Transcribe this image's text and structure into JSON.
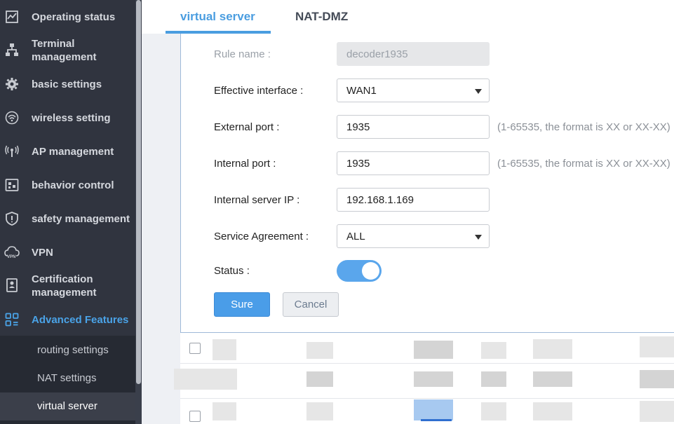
{
  "sidebar": {
    "items": [
      {
        "label": "Operating status",
        "icon": "chart-icon"
      },
      {
        "label": "Terminal\nmanagement",
        "icon": "network-icon"
      },
      {
        "label": "basic settings",
        "icon": "gear-icon"
      },
      {
        "label": "wireless setting",
        "icon": "wifi-icon"
      },
      {
        "label": "AP management",
        "icon": "antenna-icon"
      },
      {
        "label": "behavior control",
        "icon": "behavior-icon"
      },
      {
        "label": "safety management",
        "icon": "shield-icon"
      },
      {
        "label": "VPN",
        "icon": "vpn-cloud-icon"
      },
      {
        "label": "Certification\nmanagement",
        "icon": "certificate-icon"
      },
      {
        "label": "Advanced Features",
        "icon": "grid-icon",
        "active": true
      }
    ],
    "submenu": [
      {
        "label": "routing settings"
      },
      {
        "label": "NAT settings"
      },
      {
        "label": "virtual server",
        "active": true
      }
    ]
  },
  "tabs": [
    {
      "label": "virtual server",
      "active": true
    },
    {
      "label": "NAT-DMZ"
    }
  ],
  "form": {
    "rule_name": {
      "label": "Rule name :",
      "value": "decoder1935"
    },
    "effective_interface": {
      "label": "Effective interface :",
      "value": "WAN1"
    },
    "external_port": {
      "label": "External port :",
      "value": "1935",
      "hint": "(1-65535, the format is XX or XX-XX)"
    },
    "internal_port": {
      "label": "Internal port :",
      "value": "1935",
      "hint": "(1-65535, the format is XX or XX-XX)"
    },
    "internal_server_ip": {
      "label": "Internal server IP :",
      "value": "192.168.1.169"
    },
    "service_agreement": {
      "label": "Service Agreement :",
      "value": "ALL"
    },
    "status": {
      "label": "Status :",
      "enabled": true
    },
    "sure_label": "Sure",
    "cancel_label": "Cancel"
  },
  "colors": {
    "accent": "#4a9de0",
    "sidebar_bg": "#30343f",
    "toggle_on": "#5aa6ec"
  }
}
